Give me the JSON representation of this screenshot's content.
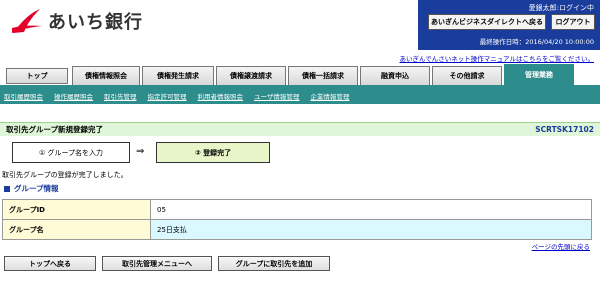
{
  "brand": {
    "name": "あいち銀行",
    "accent_color": "#e4002b"
  },
  "header": {
    "user_status": "愛銀太郎:ログイン中",
    "direct_button": "あいぎんビジネスダイレクトへ戻る",
    "logout_button": "ログアウト",
    "last_operation": "最終操作日時：2016/04/20 10:00:00",
    "manual_link": "あいぎんでんさいネット操作マニュアルはこちらをご覧ください。"
  },
  "tabs": [
    "トップ",
    "債権情報照会",
    "債権発生請求",
    "債権譲渡請求",
    "債権一括請求",
    "融資申込",
    "その他請求",
    "管理業務"
  ],
  "active_tab": "管理業務",
  "subnav": [
    "取引履歴照会",
    "操作履歴照会",
    "取引先管理",
    "指定許可管理",
    "利用者情報照会",
    "ユーザ情報管理",
    "企業情報管理"
  ],
  "page": {
    "title": "取引先グループ新規登録完了",
    "screen_id": "SCRTSK17102",
    "steps": [
      "① グループ名を入力",
      "② 登録完了"
    ],
    "step_arrow": "⇒",
    "message": "取引先グループの登録が完了しました。",
    "section_title": "グループ情報",
    "rows": [
      {
        "label": "グループID",
        "value": "05"
      },
      {
        "label": "グループ名",
        "value": "25日支払"
      }
    ],
    "top_link": "ページの先頭に戻る"
  },
  "buttons": {
    "back_top": "トップへ戻る",
    "partner_menu": "取引先管理メニューへ",
    "add_partner": "グループに取引先を追加"
  },
  "colors": {
    "header_blue": "#1a3c9c",
    "teal": "#2d8c8c",
    "title_green": "#dff7d8"
  }
}
